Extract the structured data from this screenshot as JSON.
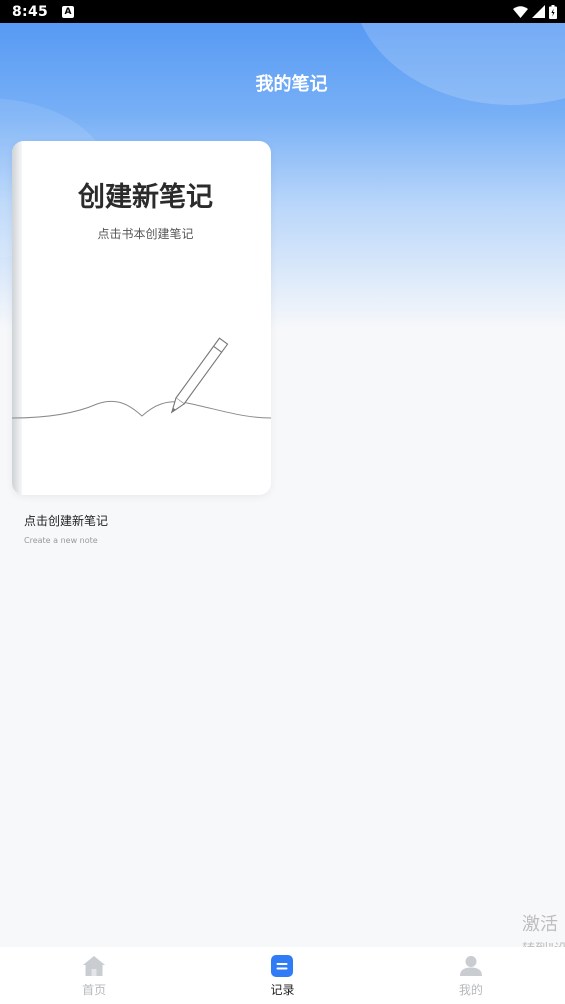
{
  "status_bar": {
    "time": "8:45",
    "badge": "A",
    "icons": [
      "wifi-icon",
      "signal-icon",
      "battery-icon"
    ]
  },
  "header": {
    "title": "我的笔记"
  },
  "note_card": {
    "heading": "创建新笔记",
    "subheading": "点击书本创建笔记",
    "caption": "点击创建新笔记",
    "caption_en": "Create a new note"
  },
  "watermark": {
    "line1": "激活",
    "line2": "转到\"设"
  },
  "bottom_nav": {
    "items": [
      {
        "label": "首页",
        "icon": "home-icon",
        "active": false
      },
      {
        "label": "记录",
        "icon": "notes-icon",
        "active": true
      },
      {
        "label": "我的",
        "icon": "profile-icon",
        "active": false
      }
    ]
  },
  "colors": {
    "accent": "#2f7cf6",
    "header_gradient_top": "#4f94f3",
    "nav_inactive": "#b5b8bd",
    "nav_active": "#222222"
  }
}
